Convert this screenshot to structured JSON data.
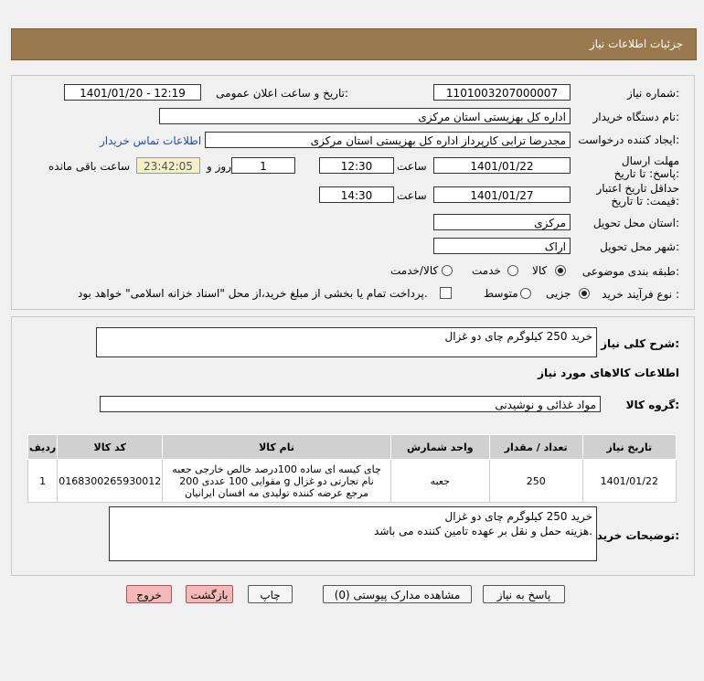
{
  "header": {
    "title": "جزئیات اطلاعات نیاز"
  },
  "form": {
    "need_number_label": "شماره نیاز:",
    "need_number": "1101003207000007",
    "announce_label": "تاریخ و ساعت اعلان عمومی:",
    "announce_value": "1401/01/20 - 12:19",
    "buyer_org_label": "نام دستگاه خریدار:",
    "buyer_org": "اداره کل بهزیستی استان مرکزی",
    "creator_label": "ایجاد کننده درخواست:",
    "creator": "مجدرضا ترابی کارپرداز اداره کل بهزیستی استان مرکزی",
    "contact_link": "اطلاعات تماس خریدار",
    "reply_deadline_label": "مهلت ارسال پاسخ: تا تاریخ:",
    "reply_date": "1401/01/22",
    "time_label": "ساعت",
    "reply_time": "12:30",
    "days_value": "1",
    "days_label": "روز و",
    "remaining_time": "23:42:05",
    "remaining_label": "ساعت باقی مانده",
    "price_validity_label": "حداقل تاریخ اعتبار قیمت: تا تاریخ:",
    "price_date": "1401/01/27",
    "price_time": "14:30",
    "province_label": "استان محل تحویل:",
    "province": "مرکزی",
    "city_label": "شهر محل تحویل:",
    "city": "اراک",
    "category_label": "طبقه بندی موضوعی:",
    "category_options": [
      "کالا",
      "خدمت",
      "کالا/خدمت"
    ],
    "process_label": "نوع فرآیند خرید :",
    "process_options": [
      "جزیی",
      "متوسط"
    ],
    "payment_note": "پرداخت تمام یا بخشی از مبلغ خرید،از محل \"اسناد خزانه اسلامی\" خواهد بود."
  },
  "details": {
    "summary_label": "شرح کلی نیاز:",
    "summary": "خرید 250 کیلوگرم چای دو غزال",
    "goods_info_title": "اطلاعات کالاهای مورد نیاز",
    "goods_group_label": "گروه کالا:",
    "goods_group": "مواد غذائی و نوشیدنی",
    "table": {
      "headers": [
        "ردیف",
        "کد کالا",
        "نام کالا",
        "واحد شمارش",
        "تعداد / مقدار",
        "تاریخ نیاز"
      ],
      "rows": [
        {
          "index": "1",
          "code": "0168300265930012",
          "name": "چای کیسه ای ساده 100درصد خالص خارجی جعبه مقوایی 100 عددی 200 g نام تجارتی دو غزال مرجع عرضه کننده تولیدی مه افسان ایرانیان",
          "unit": "جعبه",
          "qty": "250",
          "date": "1401/01/22"
        }
      ]
    },
    "buyer_notes_label": "توضیحات خریدار:",
    "buyer_notes_line1": "خرید 250 کیلوگرم چای دو غزال",
    "buyer_notes_line2": "هزینه حمل و نقل بر عهده تامین کننده می باشد."
  },
  "buttons": {
    "reply": "پاسخ به نیاز",
    "view_docs": "مشاهده مدارک پیوستی (0)",
    "print": "چاپ",
    "back": "بازگشت",
    "exit": "خروج"
  }
}
